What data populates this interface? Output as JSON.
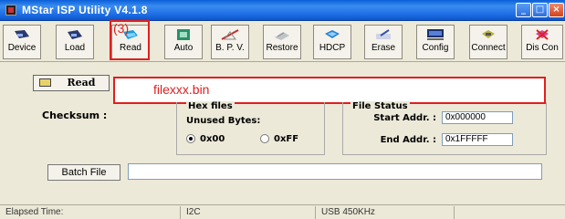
{
  "window": {
    "title": "MStar ISP Utility V4.1.8",
    "controls": [
      "minimize",
      "maximize",
      "close"
    ]
  },
  "toolbar": {
    "buttons": [
      {
        "label": "Device",
        "icon": "device-icon"
      },
      {
        "label": "Load",
        "icon": "load-icon"
      },
      {
        "label": "Read",
        "icon": "read-icon"
      },
      {
        "label": "Auto",
        "icon": "auto-icon"
      },
      {
        "label": "B. P. V.",
        "icon": "bpv-icon"
      },
      {
        "label": "Restore",
        "icon": "restore-icon"
      },
      {
        "label": "HDCP",
        "icon": "hdcp-icon"
      },
      {
        "label": "Erase",
        "icon": "erase-icon"
      },
      {
        "label": "Config",
        "icon": "config-icon"
      },
      {
        "label": "Connect",
        "icon": "connect-icon"
      },
      {
        "label": "Dis Con",
        "icon": "disconnect-icon"
      }
    ]
  },
  "annotation": {
    "step": "(3)",
    "filename": "filexxx.bin",
    "color": "#e21e1e"
  },
  "main": {
    "read_button": "Read",
    "checksum_label": "Checksum :",
    "hex_group_title": "Hex files",
    "unused_bytes_label": "Unused Bytes:",
    "radio_00": "0x00",
    "radio_ff": "0xFF",
    "radio_selected": "0x00",
    "file_status_title": "File Status",
    "start_label": "Start Addr. :",
    "start_value": "0x000000",
    "end_label": "End Addr. :",
    "end_value": "0x1FFFFF",
    "batch_button": "Batch File"
  },
  "statusbar": {
    "elapsed": "Elapsed Time:",
    "bus": "I2C",
    "usb": "USB 450KHz"
  }
}
